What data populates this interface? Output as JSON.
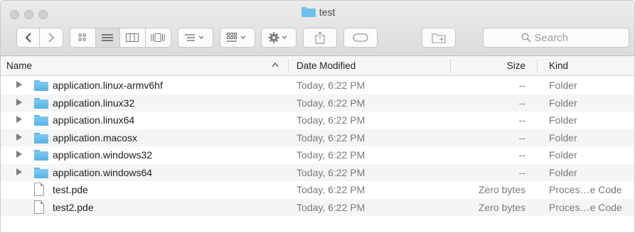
{
  "window": {
    "title": "test"
  },
  "toolbar": {
    "back_icon": "chevron-left-icon",
    "forward_icon": "chevron-right-icon",
    "view_icons": [
      "icon-view-icon",
      "list-view-icon",
      "column-view-icon",
      "cover-flow-icon"
    ],
    "arrange_icon": "arrange-icon",
    "group_icon": "group-icon",
    "action_icon": "gear-icon",
    "share_icon": "share-icon",
    "tags_icon": "tag-icon",
    "new_folder_icon": "new-folder-icon",
    "search_placeholder": "Search"
  },
  "columns": {
    "name": "Name",
    "date": "Date Modified",
    "size": "Size",
    "kind": "Kind"
  },
  "rows": [
    {
      "name": "application.linux-armv6hf",
      "date": "Today, 6:22 PM",
      "size": "--",
      "kind": "Folder",
      "type": "folder"
    },
    {
      "name": "application.linux32",
      "date": "Today, 6:22 PM",
      "size": "--",
      "kind": "Folder",
      "type": "folder"
    },
    {
      "name": "application.linux64",
      "date": "Today, 6:22 PM",
      "size": "--",
      "kind": "Folder",
      "type": "folder"
    },
    {
      "name": "application.macosx",
      "date": "Today, 6:22 PM",
      "size": "--",
      "kind": "Folder",
      "type": "folder"
    },
    {
      "name": "application.windows32",
      "date": "Today, 6:22 PM",
      "size": "--",
      "kind": "Folder",
      "type": "folder"
    },
    {
      "name": "application.windows64",
      "date": "Today, 6:22 PM",
      "size": "--",
      "kind": "Folder",
      "type": "folder"
    },
    {
      "name": "test.pde",
      "date": "Today, 6:22 PM",
      "size": "Zero bytes",
      "kind": "Proces…e Code",
      "type": "file"
    },
    {
      "name": "test2.pde",
      "date": "Today, 6:22 PM",
      "size": "Zero bytes",
      "kind": "Proces…e Code",
      "type": "file"
    }
  ],
  "colors": {
    "folder": "#5cb6e8",
    "row_alt": "#f4f5f5"
  }
}
